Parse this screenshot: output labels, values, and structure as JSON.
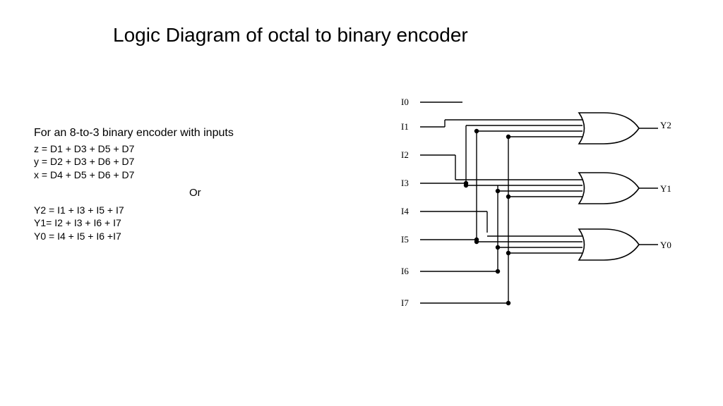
{
  "title": "Logic Diagram of octal to binary encoder",
  "intro": "For an 8-to-3 binary encoder with inputs",
  "eq_z": "z = D1 + D3 + D5 + D7",
  "eq_y": "y = D2 + D3 + D6 + D7",
  "eq_x": "x = D4 + D5 + D6 + D7",
  "or_label": "Or",
  "eq_y2": "Y2 = I1 + I3 + I5 + I7",
  "eq_y1": "Y1= I2 + I3 + I6 + I7",
  "eq_y0": "Y0 = I4 + I5 + I6 +I7",
  "inputs": [
    "I0",
    "I1",
    "I2",
    "I3",
    "I4",
    "I5",
    "I6",
    "I7"
  ],
  "outputs": [
    "Y2",
    "Y1",
    "Y0"
  ],
  "chart_data": {
    "type": "logic-diagram",
    "description": "Octal (8) to binary (3) encoder using three 4-input OR gates",
    "inputs": [
      "I0",
      "I1",
      "I2",
      "I3",
      "I4",
      "I5",
      "I6",
      "I7"
    ],
    "outputs": [
      "Y2",
      "Y1",
      "Y0"
    ],
    "gates": [
      {
        "name": "Y2",
        "type": "OR",
        "inputs": [
          "I1",
          "I3",
          "I5",
          "I7"
        ]
      },
      {
        "name": "Y1",
        "type": "OR",
        "inputs": [
          "I2",
          "I3",
          "I6",
          "I7"
        ]
      },
      {
        "name": "Y0",
        "type": "OR",
        "inputs": [
          "I4",
          "I5",
          "I6",
          "I7"
        ]
      }
    ]
  }
}
